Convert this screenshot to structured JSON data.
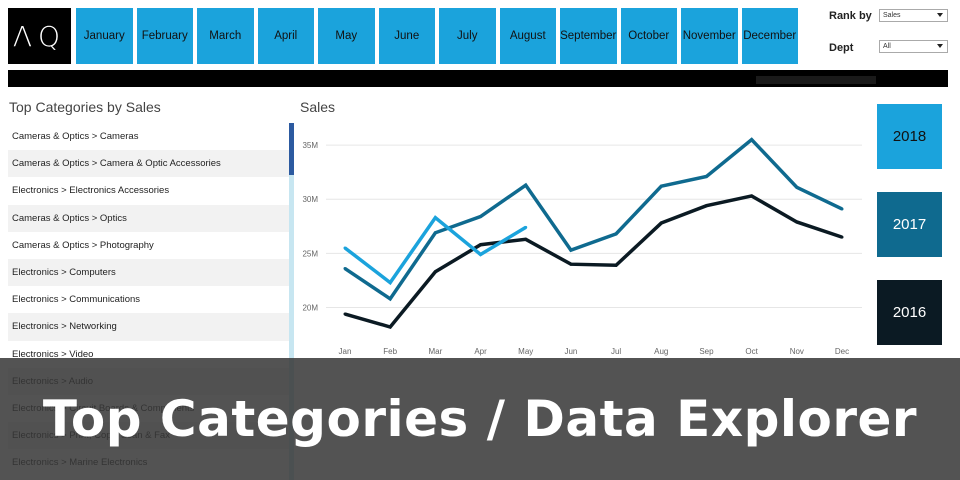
{
  "logo": "ΛQ",
  "months": [
    "January",
    "February",
    "March",
    "April",
    "May",
    "June",
    "July",
    "August",
    "September",
    "October",
    "November",
    "December"
  ],
  "filters": {
    "rank_by_label": "Rank by",
    "rank_by_value": "Sales",
    "dept_label": "Dept",
    "dept_value": "All"
  },
  "left_panel": {
    "title": "Top Categories by Sales",
    "categories": [
      "Cameras & Optics > Cameras",
      "Cameras & Optics > Camera & Optic Accessories",
      "Electronics > Electronics Accessories",
      "Cameras & Optics > Optics",
      "Cameras & Optics > Photography",
      "Electronics > Computers",
      "Electronics > Communications",
      "Electronics > Networking",
      "Electronics > Video",
      "Electronics > Audio",
      "Electronics > Circuit Boards & Components",
      "Electronics > Print, Copy, Scan & Fax",
      "Electronics > Marine Electronics"
    ]
  },
  "years": [
    {
      "label": "2018",
      "color": "#1ba3dc",
      "text_color": "#111111"
    },
    {
      "label": "2017",
      "color": "#0f6a8f",
      "text_color": "#ffffff"
    },
    {
      "label": "2016",
      "color": "#0b1a23",
      "text_color": "#ffffff"
    }
  ],
  "overlay_title": "Top Categories / Data Explorer",
  "chart_data": {
    "type": "line",
    "title": "Sales",
    "x": [
      "Jan",
      "Feb",
      "Mar",
      "Apr",
      "May",
      "Jun",
      "Jul",
      "Aug",
      "Sep",
      "Oct",
      "Nov",
      "Dec"
    ],
    "y_ticks": [
      "20M",
      "25M",
      "30M",
      "35M"
    ],
    "ylim": [
      17000000,
      37500000
    ],
    "grid": true,
    "series": [
      {
        "name": "2016",
        "color": "#0b1a23",
        "values": [
          19400000,
          18200000,
          23300000,
          25800000,
          26300000,
          24000000,
          23900000,
          27800000,
          29400000,
          30300000,
          27900000,
          26500000
        ]
      },
      {
        "name": "2017",
        "color": "#0f6a8f",
        "values": [
          23600000,
          20800000,
          26900000,
          28400000,
          31300000,
          25300000,
          26800000,
          31200000,
          32100000,
          35500000,
          31100000,
          29100000
        ]
      },
      {
        "name": "2018",
        "color": "#1ba3dc",
        "values": [
          25500000,
          22300000,
          28300000,
          24900000,
          27400000
        ]
      }
    ]
  }
}
